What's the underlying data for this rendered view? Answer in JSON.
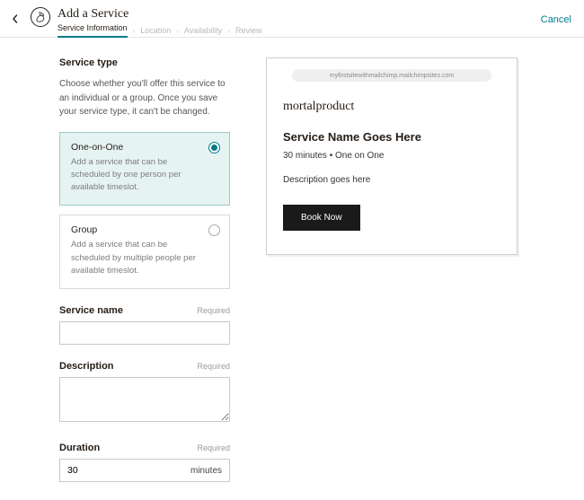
{
  "header": {
    "title": "Add a Service",
    "cancel": "Cancel",
    "breadcrumb": {
      "step1": "Service Information",
      "step2": "Location",
      "step3": "Availability",
      "step4": "Review"
    }
  },
  "form": {
    "service_type": {
      "title": "Service type",
      "description": "Choose whether you'll offer this service to an individual or a group. Once you save your service type, it can't be changed.",
      "one_on_one": {
        "title": "One-on-One",
        "desc": "Add a service that can be scheduled by one person per available timeslot."
      },
      "group": {
        "title": "Group",
        "desc": "Add a service that can be scheduled by multiple people per available timeslot."
      }
    },
    "service_name": {
      "label": "Service name",
      "required": "Required",
      "value": ""
    },
    "description": {
      "label": "Description",
      "required": "Required",
      "value": ""
    },
    "duration": {
      "label": "Duration",
      "required": "Required",
      "value": "30",
      "unit": "minutes"
    }
  },
  "preview": {
    "url": "myfirstsitewithmailchimp.mailchimpsites.com",
    "brand": "mortalproduct",
    "service_name": "Service Name Goes Here",
    "meta": "30 minutes • One on One",
    "description": "Description goes here",
    "book": "Book Now"
  }
}
